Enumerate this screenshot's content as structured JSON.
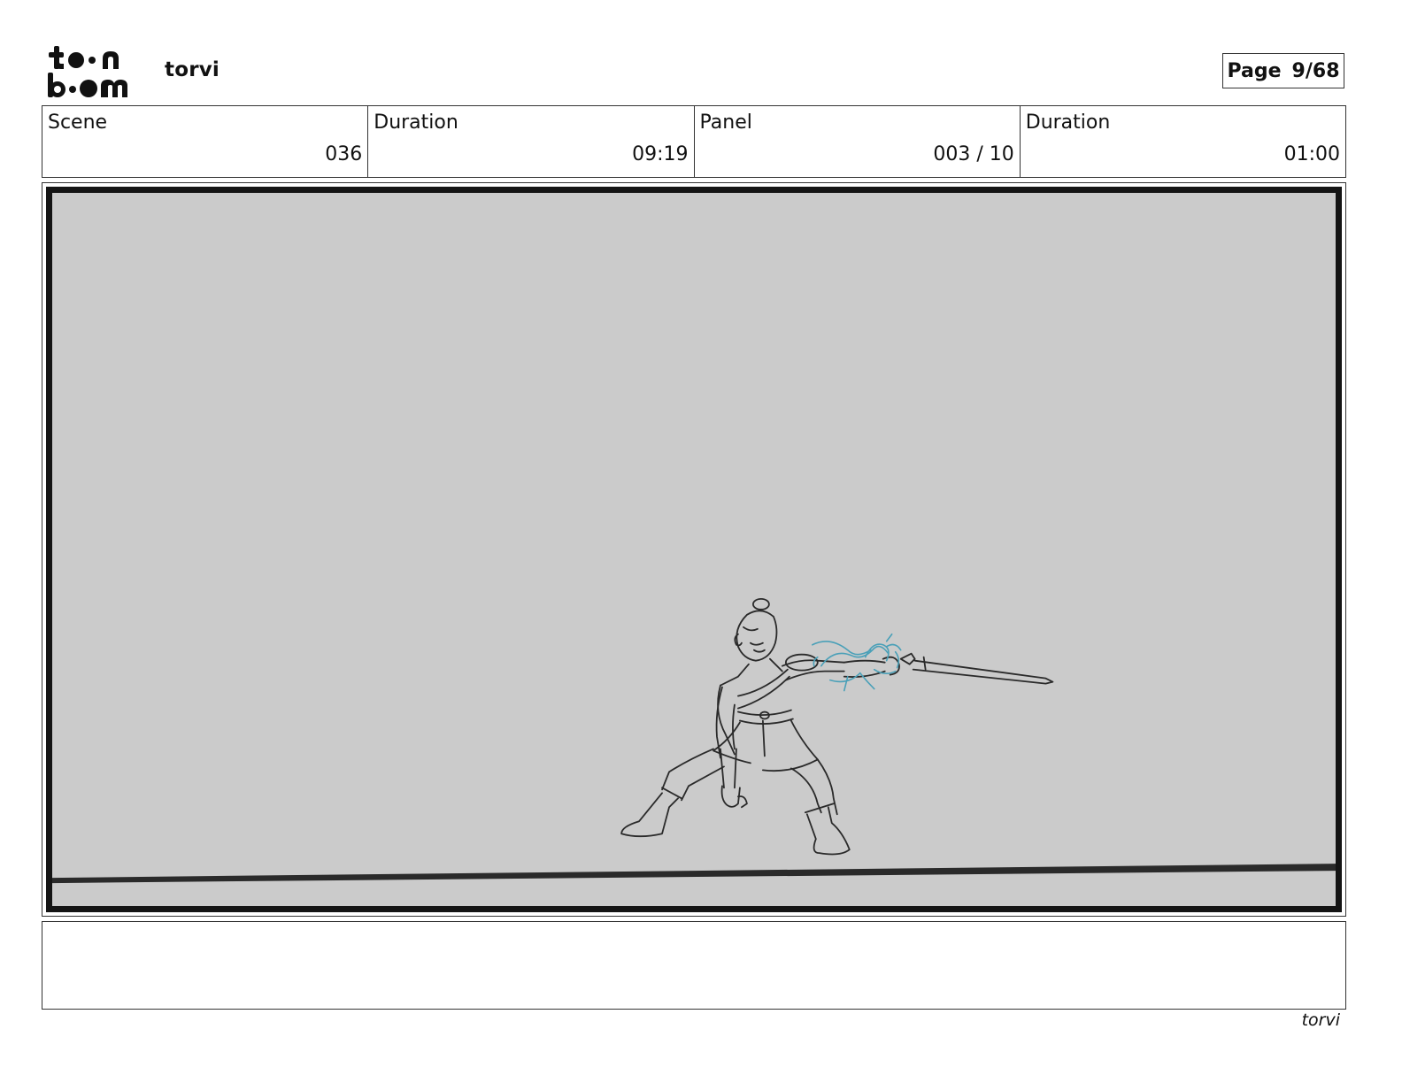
{
  "header": {
    "logo_text": "toon boom",
    "project_title": "torvi",
    "page_label": "Page",
    "page_value": "9/68"
  },
  "info": [
    {
      "label": "Scene",
      "value": "036"
    },
    {
      "label": "Duration",
      "value": "09:19"
    },
    {
      "label": "Panel",
      "value": "003 / 10"
    },
    {
      "label": "Duration",
      "value": "01:00"
    }
  ],
  "panel": {
    "background_color": "#cbcbcb",
    "frame_color": "#141414",
    "sketch_line_color": "#2a2a2a",
    "effect_color": "#4aa0b8"
  },
  "footer": {
    "project_name": "torvi"
  }
}
